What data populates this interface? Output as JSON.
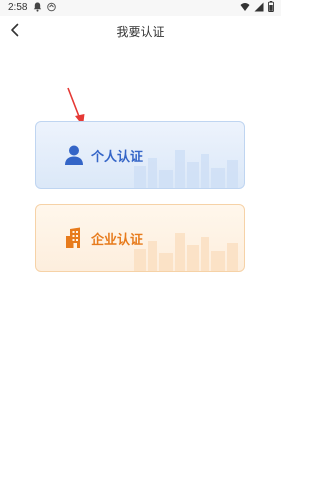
{
  "status_bar": {
    "time": "2:58",
    "icons": [
      "notification-icon",
      "sync-icon",
      "wifi-icon",
      "signal-icon",
      "battery-icon"
    ]
  },
  "header": {
    "title": "我要认证",
    "back_icon": "chevron-left-icon"
  },
  "cards": [
    {
      "label": "个人认证",
      "icon": "person-icon",
      "accent": "#3465c7",
      "background": "#e4edfa",
      "border": "#bfd5f1"
    },
    {
      "label": "企业认证",
      "icon": "building-icon",
      "accent": "#e77b1c",
      "background": "#fff3e3",
      "border": "#f6d2a7"
    }
  ],
  "annotation": {
    "arrow_color": "#e53935",
    "arrow_icon": "red-arrow-icon"
  }
}
